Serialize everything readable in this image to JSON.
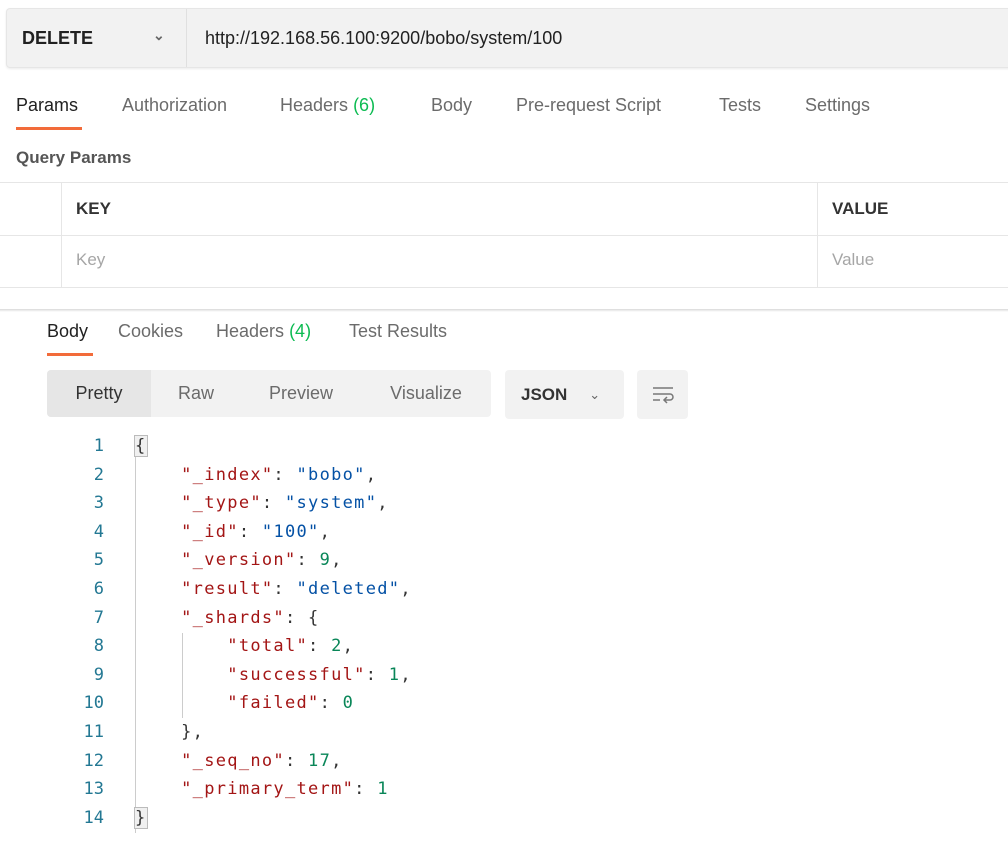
{
  "request": {
    "method": "DELETE",
    "url": "http://192.168.56.100:9200/bobo/system/100"
  },
  "request_tabs": [
    {
      "label": "Params",
      "active": true
    },
    {
      "label": "Authorization"
    },
    {
      "label": "Headers",
      "count": "(6)"
    },
    {
      "label": "Body"
    },
    {
      "label": "Pre-request Script"
    },
    {
      "label": "Tests"
    },
    {
      "label": "Settings"
    }
  ],
  "query_params": {
    "title": "Query Params",
    "columns": [
      "KEY",
      "VALUE"
    ],
    "key_placeholder": "Key",
    "value_placeholder": "Value"
  },
  "response_tabs": [
    {
      "label": "Body",
      "active": true
    },
    {
      "label": "Cookies"
    },
    {
      "label": "Headers",
      "count": "(4)"
    },
    {
      "label": "Test Results"
    }
  ],
  "view_modes": [
    "Pretty",
    "Raw",
    "Preview",
    "Visualize"
  ],
  "active_view": "Pretty",
  "format": "JSON",
  "icons": {
    "wrap": "wrap-lines-icon",
    "chevron": "chevron-down-icon"
  },
  "colors": {
    "accent": "#f26b3a",
    "count": "#0cbb52",
    "key": "#a31515",
    "string": "#0451a5",
    "number": "#098658",
    "line_number": "#237893"
  },
  "code_lines": [
    [
      [
        "p",
        "{"
      ]
    ],
    [
      [
        "p",
        "    "
      ],
      [
        "k",
        "\"_index\""
      ],
      [
        "p",
        ": "
      ],
      [
        "s",
        "\"bobo\""
      ],
      [
        "p",
        ","
      ]
    ],
    [
      [
        "p",
        "    "
      ],
      [
        "k",
        "\"_type\""
      ],
      [
        "p",
        ": "
      ],
      [
        "s",
        "\"system\""
      ],
      [
        "p",
        ","
      ]
    ],
    [
      [
        "p",
        "    "
      ],
      [
        "k",
        "\"_id\""
      ],
      [
        "p",
        ": "
      ],
      [
        "s",
        "\"100\""
      ],
      [
        "p",
        ","
      ]
    ],
    [
      [
        "p",
        "    "
      ],
      [
        "k",
        "\"_version\""
      ],
      [
        "p",
        ": "
      ],
      [
        "n",
        "9"
      ],
      [
        "p",
        ","
      ]
    ],
    [
      [
        "p",
        "    "
      ],
      [
        "k",
        "\"result\""
      ],
      [
        "p",
        ": "
      ],
      [
        "s",
        "\"deleted\""
      ],
      [
        "p",
        ","
      ]
    ],
    [
      [
        "p",
        "    "
      ],
      [
        "k",
        "\"_shards\""
      ],
      [
        "p",
        ": {"
      ]
    ],
    [
      [
        "p",
        "        "
      ],
      [
        "k",
        "\"total\""
      ],
      [
        "p",
        ": "
      ],
      [
        "n",
        "2"
      ],
      [
        "p",
        ","
      ]
    ],
    [
      [
        "p",
        "        "
      ],
      [
        "k",
        "\"successful\""
      ],
      [
        "p",
        ": "
      ],
      [
        "n",
        "1"
      ],
      [
        "p",
        ","
      ]
    ],
    [
      [
        "p",
        "        "
      ],
      [
        "k",
        "\"failed\""
      ],
      [
        "p",
        ": "
      ],
      [
        "n",
        "0"
      ]
    ],
    [
      [
        "p",
        "    },"
      ]
    ],
    [
      [
        "p",
        "    "
      ],
      [
        "k",
        "\"_seq_no\""
      ],
      [
        "p",
        ": "
      ],
      [
        "n",
        "17"
      ],
      [
        "p",
        ","
      ]
    ],
    [
      [
        "p",
        "    "
      ],
      [
        "k",
        "\"_primary_term\""
      ],
      [
        "p",
        ": "
      ],
      [
        "n",
        "1"
      ]
    ],
    [
      [
        "p",
        "}"
      ]
    ]
  ]
}
